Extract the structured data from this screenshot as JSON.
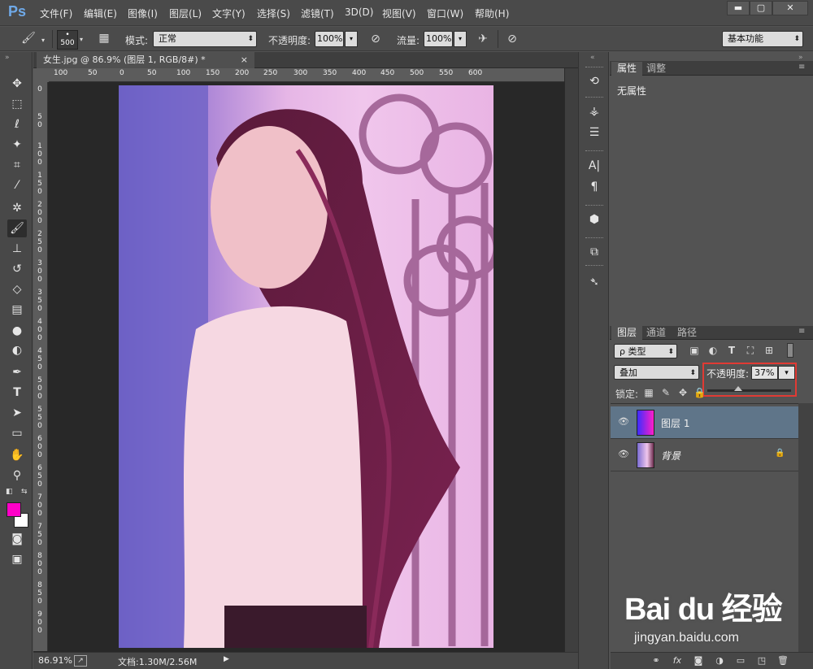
{
  "app": {
    "logo": "Ps"
  },
  "menu": [
    "文件(F)",
    "编辑(E)",
    "图像(I)",
    "图层(L)",
    "文字(Y)",
    "选择(S)",
    "滤镜(T)",
    "3D(D)",
    "视图(V)",
    "窗口(W)",
    "帮助(H)"
  ],
  "window_buttons": {
    "minimize": "▬",
    "maximize": "▢",
    "close": "✕"
  },
  "options": {
    "brush_size": "500",
    "mode_label": "模式:",
    "mode_value": "正常",
    "opacity_label": "不透明度:",
    "opacity_value": "100%",
    "flow_label": "流量:",
    "flow_value": "100%",
    "workspace": "基本功能"
  },
  "tools": [
    "move-tool-icon",
    "marquee-tool-icon",
    "lasso-tool-icon",
    "magic-wand-icon",
    "crop-tool-icon",
    "eyedropper-icon",
    "healing-brush-icon",
    "brush-tool-icon",
    "clone-stamp-icon",
    "history-brush-icon",
    "eraser-icon",
    "gradient-icon",
    "blur-icon",
    "dodge-icon",
    "pen-tool-icon",
    "type-tool-icon",
    "path-select-icon",
    "rectangle-tool-icon",
    "hand-tool-icon",
    "zoom-tool-icon"
  ],
  "colors": {
    "foreground": "#ff00c8",
    "background": "#ffffff",
    "highlight": "#e03a34",
    "selected_row": "#5f7589"
  },
  "document": {
    "tab_title": "女生.jpg @ 86.9% (图层 1, RGB/8#) *",
    "close": "×",
    "ruler_top": [
      "100",
      "50",
      "0",
      "50",
      "100",
      "150",
      "200",
      "250",
      "300",
      "350",
      "400",
      "450",
      "500",
      "550",
      "600"
    ],
    "ruler_left": [
      "0",
      "50",
      "100",
      "150",
      "200",
      "250",
      "300",
      "350",
      "400",
      "450",
      "500",
      "550",
      "600",
      "650",
      "700",
      "750",
      "800",
      "850",
      "900"
    ]
  },
  "status": {
    "zoom": "86.91%",
    "doc": "文档:1.30M/2.56M",
    "arrow": "▶"
  },
  "properties": {
    "tabs": [
      "属性",
      "调整"
    ],
    "content": "无属性"
  },
  "layers_panel": {
    "tabs": [
      "图层",
      "通道",
      "路径"
    ],
    "filter": "ρ 类型",
    "blend_mode": "叠加",
    "opacity_label": "不透明度:",
    "opacity_value": "37%",
    "opacity_fraction": 0.37,
    "lock_label": "锁定:",
    "layers": [
      {
        "name": "图层 1",
        "selected": true
      },
      {
        "name": "背景",
        "selected": false
      }
    ]
  },
  "watermark": {
    "brand": "Bai du 经验",
    "url": "jingyan.baidu.com"
  }
}
